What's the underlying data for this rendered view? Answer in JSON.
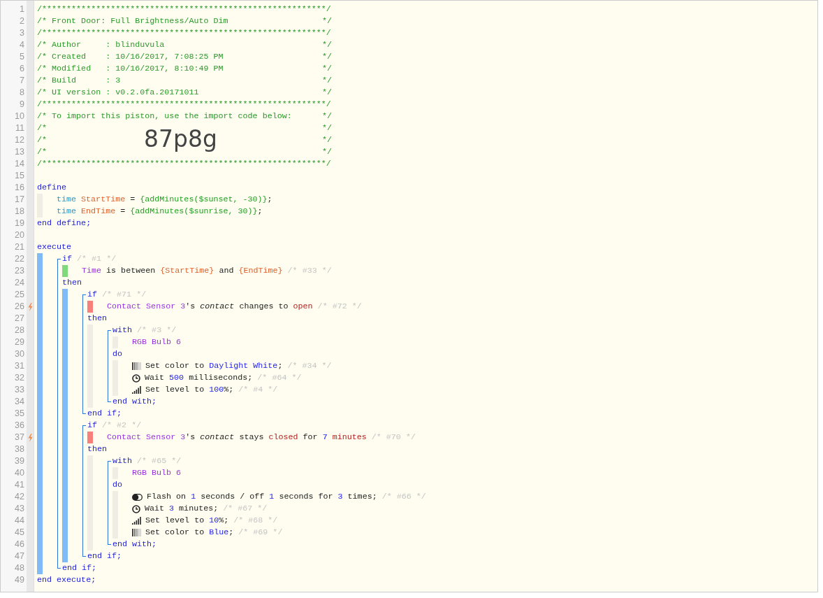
{
  "line_numbers": [
    {
      "number": "1",
      "trigger": false
    },
    {
      "number": "2",
      "trigger": false
    },
    {
      "number": "3",
      "trigger": false
    },
    {
      "number": "4",
      "trigger": false
    },
    {
      "number": "5",
      "trigger": false
    },
    {
      "number": "6",
      "trigger": false
    },
    {
      "number": "7",
      "trigger": false
    },
    {
      "number": "8",
      "trigger": false
    },
    {
      "number": "9",
      "trigger": false
    },
    {
      "number": "10",
      "trigger": false
    },
    {
      "number": "11",
      "trigger": false
    },
    {
      "number": "12",
      "trigger": false
    },
    {
      "number": "13",
      "trigger": false
    },
    {
      "number": "14",
      "trigger": false
    },
    {
      "number": "15",
      "trigger": false
    },
    {
      "number": "16",
      "trigger": false
    },
    {
      "number": "17",
      "trigger": false
    },
    {
      "number": "18",
      "trigger": false
    },
    {
      "number": "19",
      "trigger": false
    },
    {
      "number": "20",
      "trigger": false
    },
    {
      "number": "21",
      "trigger": false
    },
    {
      "number": "22",
      "trigger": false
    },
    {
      "number": "23",
      "trigger": false
    },
    {
      "number": "24",
      "trigger": false
    },
    {
      "number": "25",
      "trigger": false
    },
    {
      "number": "26",
      "trigger": true
    },
    {
      "number": "27",
      "trigger": false
    },
    {
      "number": "28",
      "trigger": false
    },
    {
      "number": "29",
      "trigger": false
    },
    {
      "number": "30",
      "trigger": false
    },
    {
      "number": "31",
      "trigger": false
    },
    {
      "number": "32",
      "trigger": false
    },
    {
      "number": "33",
      "trigger": false
    },
    {
      "number": "34",
      "trigger": false
    },
    {
      "number": "35",
      "trigger": false
    },
    {
      "number": "36",
      "trigger": false
    },
    {
      "number": "37",
      "trigger": true
    },
    {
      "number": "38",
      "trigger": false
    },
    {
      "number": "39",
      "trigger": false
    },
    {
      "number": "40",
      "trigger": false
    },
    {
      "number": "41",
      "trigger": false
    },
    {
      "number": "42",
      "trigger": false
    },
    {
      "number": "43",
      "trigger": false
    },
    {
      "number": "44",
      "trigger": false
    },
    {
      "number": "45",
      "trigger": false
    },
    {
      "number": "46",
      "trigger": false
    },
    {
      "number": "47",
      "trigger": false
    },
    {
      "number": "48",
      "trigger": false
    },
    {
      "number": "49",
      "trigger": false
    }
  ],
  "header": {
    "lines_before": [
      {
        "text": "/**********************************************************/"
      },
      {
        "text": "/* Front Door: Full Brightness/Auto Dim",
        "end": "*/"
      },
      {
        "text": "/**********************************************************/"
      },
      {
        "text": "/* Author     : blinduvula",
        "end": "*/"
      },
      {
        "text": "/* Created    : 10/16/2017, 7:08:25 PM",
        "end": "*/"
      },
      {
        "text": "/* Modified   : 10/16/2017, 8:10:49 PM",
        "end": "*/"
      },
      {
        "text": "/* Build      : 3",
        "end": "*/"
      },
      {
        "text": "/* UI version : v0.2.0fa.20171011",
        "end": "*/"
      },
      {
        "text": "/**********************************************************/"
      },
      {
        "text": "/* To import this piston, use the import code below:",
        "end": "*/"
      }
    ],
    "import_rows": [
      {
        "left": "/*",
        "right": "*/"
      },
      {
        "left": "/*",
        "right": "*/"
      },
      {
        "left": "/*",
        "right": "*/"
      }
    ],
    "import_code": "87p8g",
    "lines_after": [
      {
        "text": "/**********************************************************/"
      }
    ]
  },
  "define": {
    "open": [
      {
        "kind": "keyword",
        "text": "define"
      }
    ],
    "variables": [
      {
        "tokens": [
          {
            "kind": "type",
            "text": "time"
          },
          {
            "kind": "var",
            "text": " StartTime"
          },
          {
            "kind": "plain",
            "text": " = "
          },
          {
            "kind": "expr",
            "text": "{addMinutes($sunset, -30)}"
          },
          {
            "kind": "plain",
            "text": ";"
          }
        ]
      },
      {
        "tokens": [
          {
            "kind": "type",
            "text": "time"
          },
          {
            "kind": "var",
            "text": " EndTime"
          },
          {
            "kind": "plain",
            "text": " = "
          },
          {
            "kind": "expr",
            "text": "{addMinutes($sunrise, 30)}"
          },
          {
            "kind": "plain",
            "text": ";"
          }
        ]
      }
    ],
    "close": [
      {
        "kind": "keyword",
        "text": "end define;"
      }
    ]
  },
  "execute": {
    "open": [
      {
        "kind": "keyword",
        "text": "execute"
      }
    ],
    "highlight": true,
    "statements": [
      {
        "kind": "if",
        "open": [
          {
            "kind": "keyword",
            "text": "if"
          },
          {
            "kind": "comment",
            "text": " /* #1 */"
          }
        ],
        "conditions": [
          {
            "result": true,
            "tokens": [
              {
                "kind": "device",
                "text": "Time"
              },
              {
                "kind": "plain",
                "text": " is between "
              },
              {
                "kind": "var",
                "text": "{StartTime}"
              },
              {
                "kind": "plain",
                "text": " and "
              },
              {
                "kind": "var",
                "text": "{EndTime}"
              },
              {
                "kind": "comment",
                "text": " /* #33 */"
              }
            ]
          }
        ],
        "then": [
          {
            "kind": "keyword",
            "text": "then"
          }
        ],
        "highlight": true,
        "statements": [
          {
            "kind": "if",
            "open": [
              {
                "kind": "keyword",
                "text": "if"
              },
              {
                "kind": "comment",
                "text": " /* #71 */"
              }
            ],
            "conditions": [
              {
                "result": false,
                "tokens": [
                  {
                    "kind": "device",
                    "text": "Contact Sensor 3"
                  },
                  {
                    "kind": "plain",
                    "text": "'s "
                  },
                  {
                    "kind": "attr",
                    "text": "contact"
                  },
                  {
                    "kind": "plain",
                    "text": " changes to "
                  },
                  {
                    "kind": "value",
                    "text": "open"
                  },
                  {
                    "kind": "comment",
                    "text": " /* #72 */"
                  }
                ]
              }
            ],
            "then": [
              {
                "kind": "keyword",
                "text": "then"
              }
            ],
            "highlight": false,
            "statements": [
              {
                "kind": "with",
                "open": [
                  {
                    "kind": "keyword",
                    "text": "with"
                  },
                  {
                    "kind": "comment",
                    "text": " /* #3 */"
                  }
                ],
                "devices": [
                  {
                    "tokens": [
                      {
                        "kind": "device",
                        "text": "RGB Bulb 6"
                      }
                    ]
                  }
                ],
                "do": [
                  {
                    "kind": "keyword",
                    "text": "do"
                  }
                ],
                "tasks": [
                  {
                    "kind": "color",
                    "tokens": [
                      {
                        "kind": "plain",
                        "text": "Set color to "
                      },
                      {
                        "kind": "number",
                        "text": "Daylight White"
                      },
                      {
                        "kind": "plain",
                        "text": ";"
                      },
                      {
                        "kind": "comment",
                        "text": " /* #34 */"
                      }
                    ]
                  },
                  {
                    "kind": "wait",
                    "tokens": [
                      {
                        "kind": "plain",
                        "text": "Wait "
                      },
                      {
                        "kind": "number",
                        "text": "500"
                      },
                      {
                        "kind": "plain",
                        "text": " milliseconds;"
                      },
                      {
                        "kind": "comment",
                        "text": " /* #64 */"
                      }
                    ]
                  },
                  {
                    "kind": "level",
                    "tokens": [
                      {
                        "kind": "plain",
                        "text": "Set level to "
                      },
                      {
                        "kind": "number",
                        "text": "100"
                      },
                      {
                        "kind": "plain",
                        "text": "%;"
                      },
                      {
                        "kind": "comment",
                        "text": " /* #4 */"
                      }
                    ]
                  }
                ],
                "close": [
                  {
                    "kind": "keyword",
                    "text": "end with;"
                  }
                ]
              }
            ],
            "close": [
              {
                "kind": "keyword",
                "text": "end if;"
              }
            ]
          },
          {
            "kind": "if",
            "open": [
              {
                "kind": "keyword",
                "text": "if"
              },
              {
                "kind": "comment",
                "text": " /* #2 */"
              }
            ],
            "conditions": [
              {
                "result": false,
                "tokens": [
                  {
                    "kind": "device",
                    "text": "Contact Sensor 3"
                  },
                  {
                    "kind": "plain",
                    "text": "'s "
                  },
                  {
                    "kind": "attr",
                    "text": "contact"
                  },
                  {
                    "kind": "plain",
                    "text": " stays "
                  },
                  {
                    "kind": "value",
                    "text": "closed"
                  },
                  {
                    "kind": "plain",
                    "text": " for "
                  },
                  {
                    "kind": "number",
                    "text": "7"
                  },
                  {
                    "kind": "value",
                    "text": " minutes"
                  },
                  {
                    "kind": "comment",
                    "text": " /* #70 */"
                  }
                ]
              }
            ],
            "then": [
              {
                "kind": "keyword",
                "text": "then"
              }
            ],
            "highlight": false,
            "statements": [
              {
                "kind": "with",
                "open": [
                  {
                    "kind": "keyword",
                    "text": "with"
                  },
                  {
                    "kind": "comment",
                    "text": " /* #65 */"
                  }
                ],
                "devices": [
                  {
                    "tokens": [
                      {
                        "kind": "device",
                        "text": "RGB Bulb 6"
                      }
                    ]
                  }
                ],
                "do": [
                  {
                    "kind": "keyword",
                    "text": "do"
                  }
                ],
                "tasks": [
                  {
                    "kind": "flash",
                    "tokens": [
                      {
                        "kind": "plain",
                        "text": "Flash on "
                      },
                      {
                        "kind": "number",
                        "text": "1"
                      },
                      {
                        "kind": "plain",
                        "text": " seconds / off "
                      },
                      {
                        "kind": "number",
                        "text": "1"
                      },
                      {
                        "kind": "plain",
                        "text": " seconds for "
                      },
                      {
                        "kind": "number",
                        "text": "3"
                      },
                      {
                        "kind": "plain",
                        "text": " times;"
                      },
                      {
                        "kind": "comment",
                        "text": " /* #66 */"
                      }
                    ]
                  },
                  {
                    "kind": "wait",
                    "tokens": [
                      {
                        "kind": "plain",
                        "text": "Wait "
                      },
                      {
                        "kind": "number",
                        "text": "3"
                      },
                      {
                        "kind": "plain",
                        "text": " minutes;"
                      },
                      {
                        "kind": "comment",
                        "text": " /* #67 */"
                      }
                    ]
                  },
                  {
                    "kind": "level",
                    "tokens": [
                      {
                        "kind": "plain",
                        "text": "Set level to "
                      },
                      {
                        "kind": "number",
                        "text": "10"
                      },
                      {
                        "kind": "plain",
                        "text": "%;"
                      },
                      {
                        "kind": "comment",
                        "text": " /* #68 */"
                      }
                    ]
                  },
                  {
                    "kind": "color",
                    "tokens": [
                      {
                        "kind": "plain",
                        "text": "Set color to "
                      },
                      {
                        "kind": "number",
                        "text": "Blue"
                      },
                      {
                        "kind": "plain",
                        "text": ";"
                      },
                      {
                        "kind": "comment",
                        "text": " /* #69 */"
                      }
                    ]
                  }
                ],
                "close": [
                  {
                    "kind": "keyword",
                    "text": "end with;"
                  }
                ]
              }
            ],
            "close": [
              {
                "kind": "keyword",
                "text": "end if;"
              }
            ]
          }
        ],
        "close": [
          {
            "kind": "keyword",
            "text": "end if;"
          }
        ]
      }
    ],
    "close": [
      {
        "kind": "keyword",
        "text": "end execute;"
      }
    ]
  }
}
